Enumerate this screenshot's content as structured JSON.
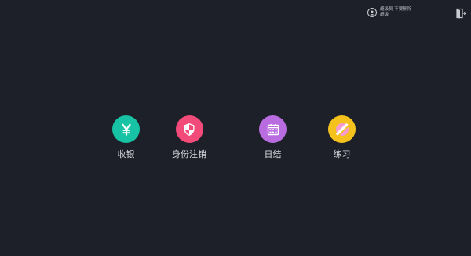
{
  "header": {
    "user_name": "超级员·不要删除",
    "user_role": "超级",
    "avatar_icon": "user-circle-icon",
    "logout_icon": "logout-door-icon"
  },
  "menu": {
    "items": [
      {
        "label": "收银",
        "icon": "yen-icon",
        "color": "#17c3a4"
      },
      {
        "label": "身份注销",
        "icon": "shield-icon",
        "color": "#f24b7a"
      },
      {
        "label": "日结",
        "icon": "calendar-icon",
        "color": "#b86ce0"
      },
      {
        "label": "练习",
        "icon": "practice-icon",
        "color": "#f5c21d"
      }
    ]
  }
}
